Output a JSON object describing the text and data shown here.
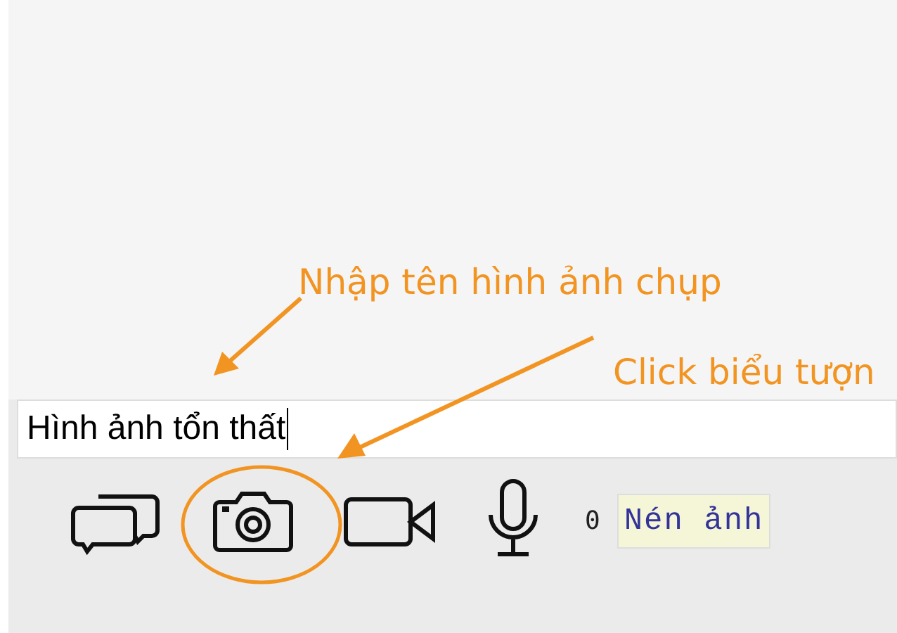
{
  "message_field": {
    "value": "Hình ảnh tổn thất"
  },
  "toolbar": {
    "counter": "0",
    "compress_button": "Nén ảnh"
  },
  "annotations": [
    {
      "text": "Nhập tên hình ảnh chụp"
    },
    {
      "text": "Click biểu tượn"
    }
  ]
}
